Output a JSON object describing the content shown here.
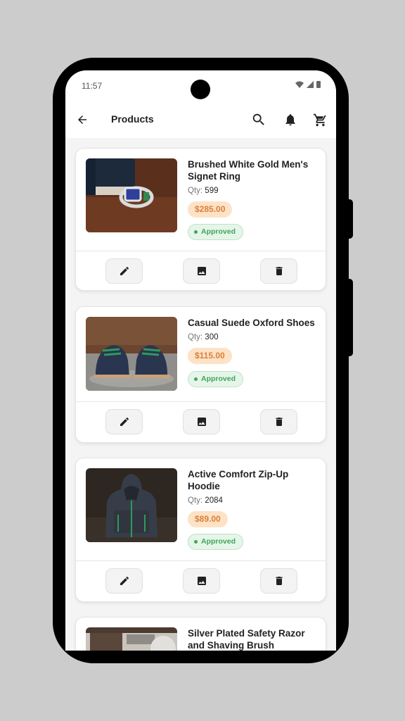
{
  "status_bar": {
    "time": "11:57"
  },
  "app_bar": {
    "title": "Products"
  },
  "icons": {
    "back": "arrow-back-icon",
    "search": "search-icon",
    "notifications": "bell-icon",
    "cart": "cart-icon",
    "edit": "pencil-icon",
    "image": "image-icon",
    "delete": "trash-icon"
  },
  "colors": {
    "price_bg": "#fde2c6",
    "price_text": "#d9803c",
    "approved_bg": "#e6f5e9",
    "approved_text": "#3fa659"
  },
  "products": [
    {
      "name": "Brushed White Gold Men's Signet Ring",
      "qty_label": "Qty:",
      "qty": "599",
      "price": "$285.00",
      "status": "Approved"
    },
    {
      "name": "Casual Suede Oxford Shoes",
      "qty_label": "Qty:",
      "qty": "300",
      "price": "$115.00",
      "status": "Approved"
    },
    {
      "name": "Active Comfort Zip-Up Hoodie",
      "qty_label": "Qty:",
      "qty": "2084",
      "price": "$89.00",
      "status": "Approved"
    },
    {
      "name": "Silver Plated Safety Razor and Shaving Brush"
    }
  ]
}
